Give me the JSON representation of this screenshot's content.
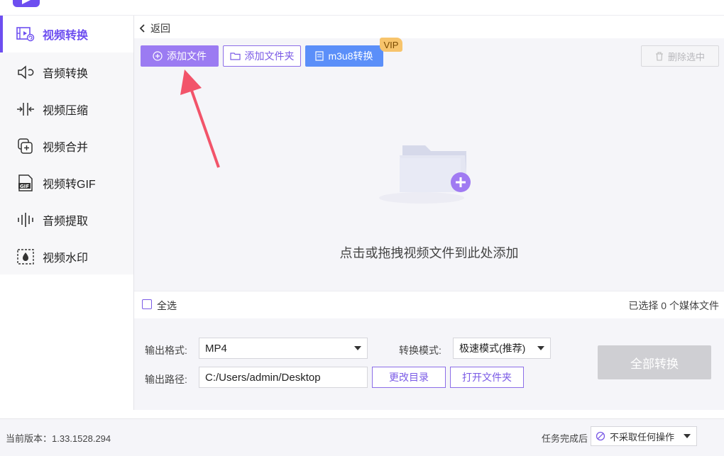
{
  "app": {
    "title": ""
  },
  "nav": {
    "back_label": "返回",
    "items": [
      {
        "label": "视频转换",
        "icon": "video-convert-icon",
        "active": true
      },
      {
        "label": "音频转换",
        "icon": "audio-convert-icon",
        "active": false
      },
      {
        "label": "视频压缩",
        "icon": "compress-icon",
        "active": false
      },
      {
        "label": "视频合并",
        "icon": "merge-icon",
        "active": false
      },
      {
        "label": "视频转GIF",
        "icon": "gif-icon",
        "active": false
      },
      {
        "label": "音频提取",
        "icon": "audio-extract-icon",
        "active": false
      },
      {
        "label": "视频水印",
        "icon": "watermark-icon",
        "active": false
      }
    ]
  },
  "toolbar": {
    "add_file": "添加文件",
    "add_folder": "添加文件夹",
    "m3u8": "m3u8转换",
    "vip": "VIP",
    "delete_selected": "删除选中"
  },
  "dropzone": {
    "hint": "点击或拖拽视频文件到此处添加"
  },
  "selection": {
    "select_all": "全选",
    "count_text": "已选择 0 个媒体文件"
  },
  "settings": {
    "output_format_label": "输出格式:",
    "output_format_value": "MP4",
    "convert_mode_label": "转换模式:",
    "convert_mode_value": "极速模式(推荐)",
    "output_path_label": "输出路径:",
    "output_path_value": "C:/Users/admin/Desktop",
    "change_dir": "更改目录",
    "open_folder": "打开文件夹",
    "convert_all": "全部转换"
  },
  "status": {
    "version": "当前版本：1.33.1528.294",
    "after_task_label": "任务完成后",
    "after_task_value": "不采取任何操作"
  },
  "colors": {
    "accent": "#6d4ef0",
    "primary_button": "#9b7bf2",
    "m3u8_button": "#5b8ff9",
    "vip": "#f7c46c",
    "arrow": "#f2546a"
  }
}
